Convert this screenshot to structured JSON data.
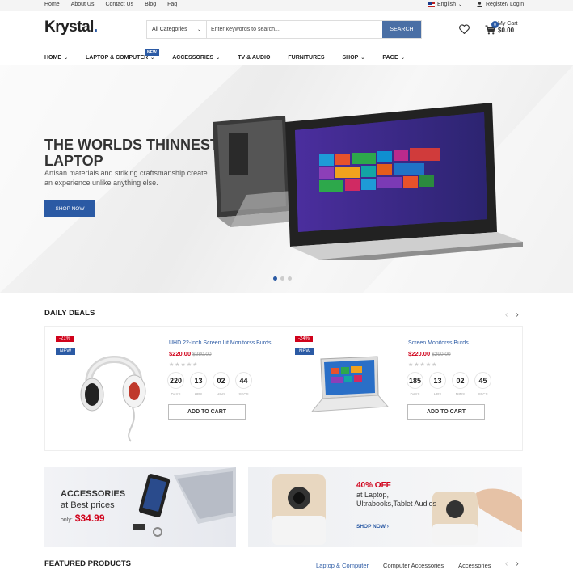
{
  "topbar": {
    "links": [
      "Home",
      "About Us",
      "Contact Us",
      "Blog",
      "Faq"
    ],
    "language": "English",
    "account": "Register/ Login"
  },
  "header": {
    "logo": "Krystal",
    "search_category": "All Categories",
    "search_placeholder": "Enter keywords to search...",
    "search_button": "SEARCH",
    "cart_count": "0",
    "cart_label": "My Cart",
    "cart_total": "$0.00"
  },
  "nav": {
    "items": [
      "HOME",
      "LAPTOP & COMPUTER",
      "ACCESSORIES",
      "TV & AUDIO",
      "FURNITURES",
      "SHOP",
      "PAGE"
    ],
    "new_badge": "NEW"
  },
  "hero": {
    "title": "THE WORLDS THINNEST LAPTOP",
    "subtitle": "Artisan materials and striking craftsmanship create an experience unlike anything else.",
    "button": "SHOP NOW"
  },
  "daily_deals": {
    "title": "DAILY DEALS",
    "deals": [
      {
        "discount": "-21%",
        "badge": "NEW",
        "name": "UHD 22-Inch Screen Lit Monitorss Burds",
        "price": "$220.00",
        "old_price": "$280.00",
        "countdown": [
          {
            "value": "220",
            "label": "DAYS"
          },
          {
            "value": "13",
            "label": "HRS"
          },
          {
            "value": "02",
            "label": "MINS"
          },
          {
            "value": "44",
            "label": "SECS"
          }
        ],
        "button": "ADD TO CART"
      },
      {
        "discount": "-24%",
        "badge": "NEW",
        "name": "Screen Monitorss Burds",
        "price": "$220.00",
        "old_price": "$290.00",
        "countdown": [
          {
            "value": "185",
            "label": "DAYS"
          },
          {
            "value": "13",
            "label": "HRS"
          },
          {
            "value": "02",
            "label": "MINS"
          },
          {
            "value": "45",
            "label": "SECS"
          }
        ],
        "button": "ADD TO CART"
      }
    ]
  },
  "banner_left": {
    "title": "ACCESSORIES",
    "subtitle": "at Best prices",
    "only_label": "only:",
    "price": "$34.99"
  },
  "banner_right": {
    "title": "40% OFF",
    "subtitle": "at Laptop, Ultrabooks,Tablet Audios",
    "link": "SHOP NOW ›"
  },
  "featured": {
    "title": "FEATURED PRODUCTS",
    "tabs": [
      "Laptop & Computer",
      "Computer Accessories",
      "Accessories"
    ]
  },
  "colors": {
    "accent": "#2b5aa4",
    "sale": "#d0021b"
  }
}
